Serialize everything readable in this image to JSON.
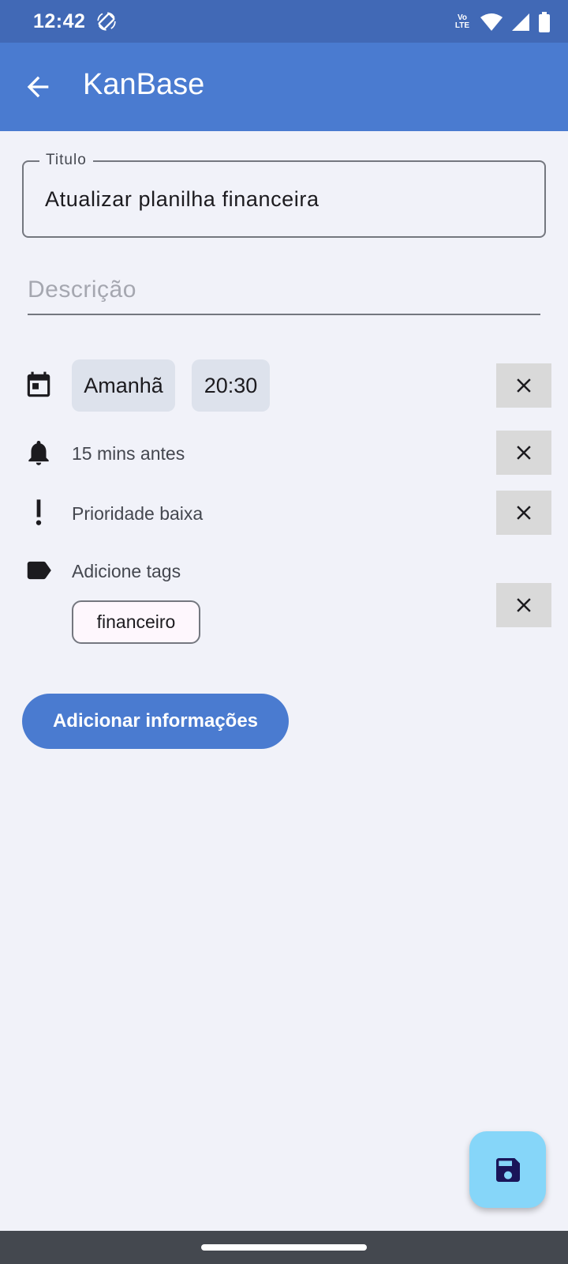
{
  "status_bar": {
    "time": "12:42",
    "volte_line1": "Vo",
    "volte_line2": "LTE",
    "icons": [
      "screen-rotate-icon",
      "volte-icon",
      "wifi-icon",
      "signal-icon",
      "battery-icon"
    ]
  },
  "app_bar": {
    "title": "KanBase",
    "back_icon": "arrow-back-icon"
  },
  "form": {
    "title_label": "Titulo",
    "title_value": "Atualizar planilha financeira",
    "description_placeholder": "Descrição"
  },
  "due": {
    "date_chip": "Amanhã",
    "time_chip": "20:30",
    "icon": "calendar-icon"
  },
  "reminder": {
    "text": "15 mins antes",
    "icon": "bell-icon"
  },
  "priority": {
    "text": "Prioridade baixa",
    "icon": "priority-icon"
  },
  "tags": {
    "label": "Adicione tags",
    "items": [
      "financeiro"
    ],
    "icon": "label-icon"
  },
  "buttons": {
    "add_info": "Adicionar informações",
    "save_icon": "save-icon",
    "clear_icon": "close-icon"
  },
  "colors": {
    "status_bar": "#4169b6",
    "app_bar": "#4a7bd0",
    "background": "#f1f2f9",
    "fab": "#86d6f9",
    "nav_bar": "#44484f"
  }
}
